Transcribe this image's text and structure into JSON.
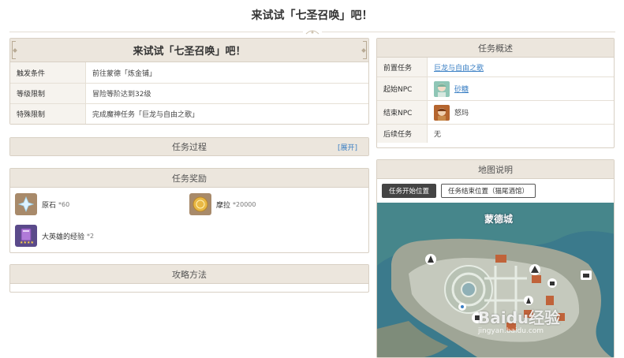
{
  "page": {
    "title": "来试试「七圣召唤」吧！"
  },
  "info_box": {
    "title": "来试试「七圣召唤」吧！",
    "rows": [
      {
        "key": "触发条件",
        "value": "前往蒙德「炼金铺」"
      },
      {
        "key": "等级限制",
        "value": "冒险等阶达到32级"
      },
      {
        "key": "特殊限制",
        "value": "完成魔神任务「巨龙与自由之歌」"
      }
    ]
  },
  "process_box": {
    "title": "任务过程",
    "expand_label": "[展开]"
  },
  "rewards_box": {
    "title": "任务奖励",
    "items": [
      {
        "name": "原石",
        "qty": "*60",
        "icon": "primogem-icon"
      },
      {
        "name": "摩拉",
        "qty": "*20000",
        "icon": "mora-icon"
      },
      {
        "name": "大英雄的经验",
        "qty": "*2",
        "icon": "heros-wit-icon"
      }
    ]
  },
  "strategy_box": {
    "title": "攻略方法"
  },
  "overview_box": {
    "title": "任务概述",
    "rows": [
      {
        "key": "前置任务",
        "value": "巨龙与自由之歌",
        "link": true
      },
      {
        "key": "起始NPC",
        "value": "砂糖",
        "link": true,
        "avatar": "sucrose-avatar"
      },
      {
        "key": "结束NPC",
        "value": "怒玛",
        "link": false,
        "avatar": "numa-avatar"
      },
      {
        "key": "后续任务",
        "value": "无",
        "link": false
      }
    ]
  },
  "map_box": {
    "title": "地图说明",
    "buttons": [
      {
        "label": "任务开始位置",
        "active": true
      },
      {
        "label": "任务结束位置（猫尾酒馆）",
        "active": false
      }
    ],
    "city_label": "蒙德城",
    "watermark": "Baidu经验",
    "watermark_url": "jingyan.baidu.com"
  },
  "colors": {
    "accent_link": "#3a7fc4",
    "header_bg": "#ece6dd",
    "border": "#d8d0c4",
    "map_water": "#2e6d80"
  }
}
